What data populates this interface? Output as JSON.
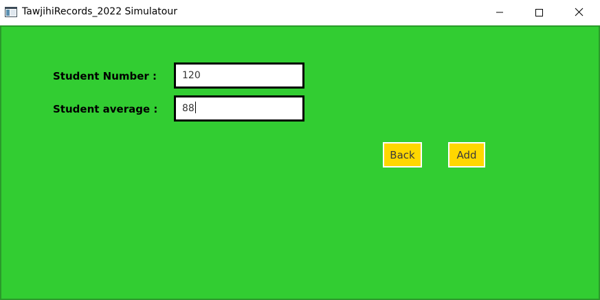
{
  "window": {
    "title": "TawjihiRecords_2022 Simulatour",
    "app_icon": "window-app-icon",
    "controls": {
      "minimize_icon": "minimize-icon",
      "maximize_icon": "maximize-icon",
      "close_icon": "close-icon"
    }
  },
  "form": {
    "student_number_label": "Student Number :",
    "student_number_value": "120",
    "student_average_label": "Student average :",
    "student_average_value": "88"
  },
  "buttons": {
    "back_label": "Back",
    "add_label": "Add"
  },
  "colors": {
    "background": "#32cd32",
    "button": "#ffd700",
    "input_border": "#000000"
  }
}
